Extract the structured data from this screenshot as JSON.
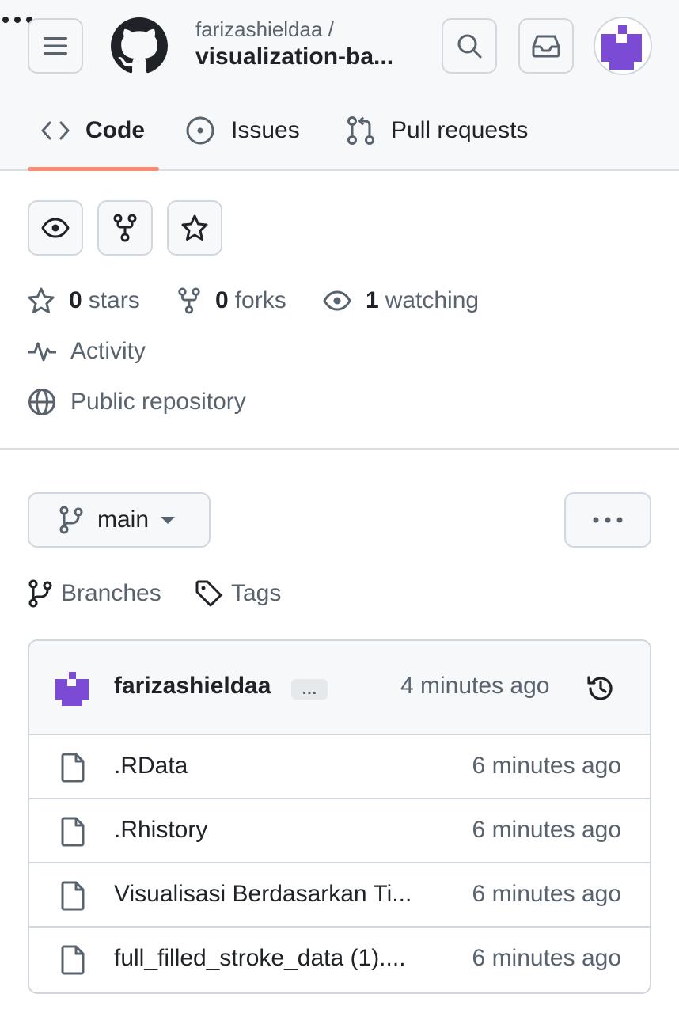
{
  "header": {
    "owner": "farizashieldaa /",
    "repo_name": "visualization-ba...",
    "avatar_color": "#7b4bd6"
  },
  "tabs": [
    {
      "label": "Code",
      "icon": "code-icon",
      "selected": true
    },
    {
      "label": "Issues",
      "icon": "issue-opened-icon",
      "selected": false
    },
    {
      "label": "Pull requests",
      "icon": "git-pull-request-icon",
      "selected": false
    }
  ],
  "stats": {
    "stars_count": "0",
    "stars_label": "stars",
    "forks_count": "0",
    "forks_label": "forks",
    "watching_count": "1",
    "watching_label": "watching"
  },
  "meta": {
    "activity": "Activity",
    "visibility": "Public repository"
  },
  "branch": {
    "current": "main",
    "branches_label": "Branches",
    "tags_label": "Tags"
  },
  "latest_commit": {
    "author": "farizashieldaa",
    "ellipsis": "…",
    "time": "4 minutes ago"
  },
  "files": [
    {
      "name": ".RData",
      "time": "6 minutes ago",
      "icon": "file-icon"
    },
    {
      "name": ".Rhistory",
      "time": "6 minutes ago",
      "icon": "file-icon"
    },
    {
      "name": "Visualisasi Berdasarkan Ti...",
      "time": "6 minutes ago",
      "icon": "file-icon"
    },
    {
      "name": "full_filled_stroke_data (1)....",
      "time": "6 minutes ago",
      "icon": "file-icon"
    }
  ],
  "colors": {
    "accent_underline": "#fd8c73",
    "text_muted": "#59636e",
    "border": "#d0d7de",
    "avatar_purple": "#7b4bd6"
  }
}
